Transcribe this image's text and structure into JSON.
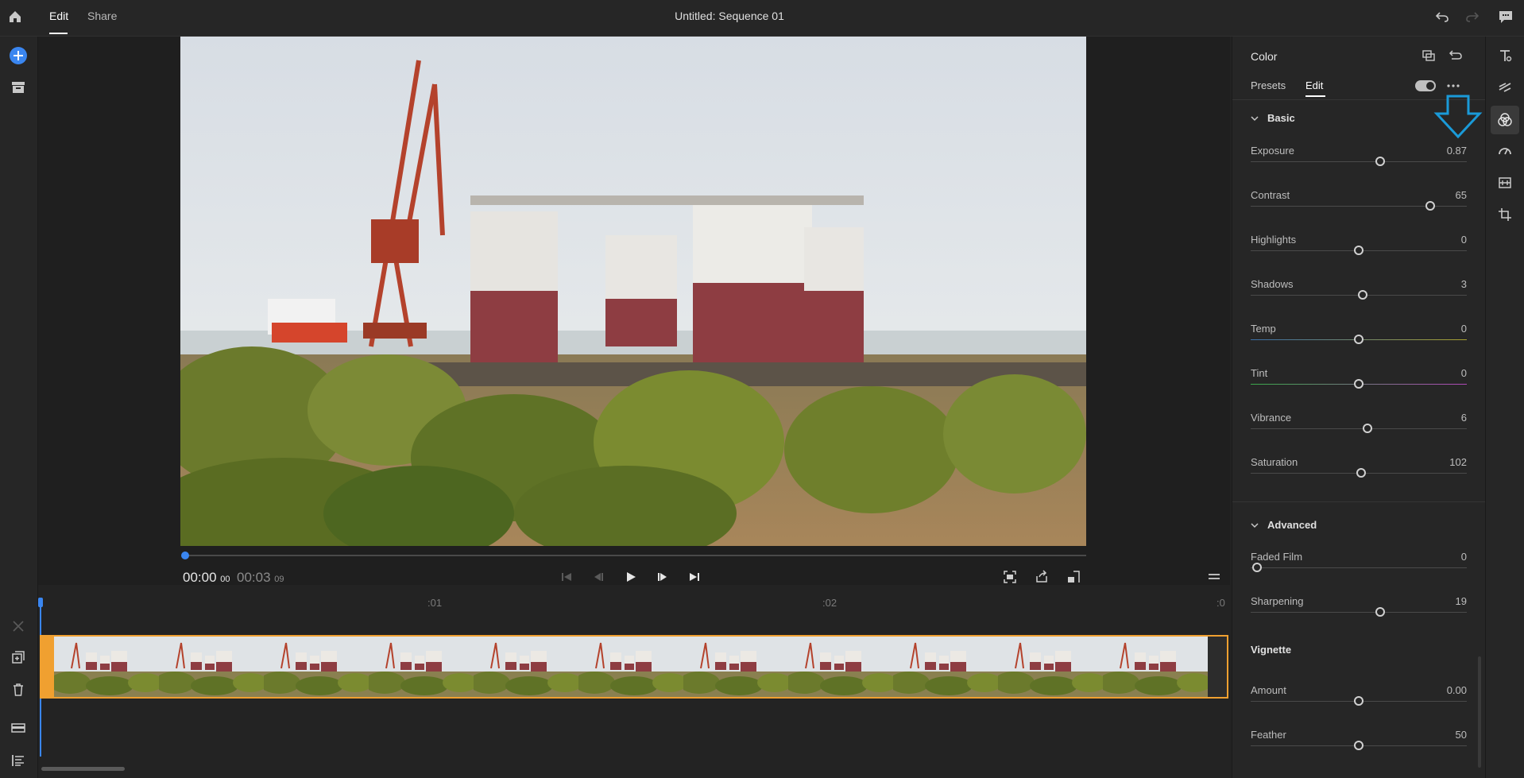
{
  "header": {
    "tabs": [
      {
        "label": "Edit"
      },
      {
        "label": "Share"
      }
    ],
    "title": "Untitled: Sequence 01"
  },
  "player": {
    "current_time": "00:00",
    "current_frames": "00",
    "duration": "00:03",
    "duration_frames": "09",
    "progress": 0.0
  },
  "timeline": {
    "ruler": [
      ":01",
      ":02",
      ":0"
    ],
    "thumb_count": 11
  },
  "panel": {
    "title": "Color",
    "tabs": [
      {
        "label": "Presets"
      },
      {
        "label": "Edit"
      }
    ],
    "basic": {
      "label": "Basic",
      "sliders": [
        {
          "name": "Exposure",
          "value": "0.87",
          "pos": 0.6
        },
        {
          "name": "Contrast",
          "value": "65",
          "pos": 0.83
        },
        {
          "name": "Highlights",
          "value": "0",
          "pos": 0.5
        },
        {
          "name": "Shadows",
          "value": "3",
          "pos": 0.52
        },
        {
          "name": "Temp",
          "value": "0",
          "pos": 0.5
        },
        {
          "name": "Tint",
          "value": "0",
          "pos": 0.5
        },
        {
          "name": "Vibrance",
          "value": "6",
          "pos": 0.54
        },
        {
          "name": "Saturation",
          "value": "102",
          "pos": 0.51
        }
      ]
    },
    "advanced": {
      "label": "Advanced",
      "sliders": [
        {
          "name": "Faded Film",
          "value": "0",
          "pos": 0.03
        },
        {
          "name": "Sharpening",
          "value": "19",
          "pos": 0.6
        }
      ]
    },
    "vignette": {
      "label": "Vignette",
      "sliders": [
        {
          "name": "Amount",
          "value": "0.00",
          "pos": 0.5
        },
        {
          "name": "Feather",
          "value": "50",
          "pos": 0.5
        }
      ]
    }
  },
  "colors": {
    "accent": "#3a86f0",
    "clip_border": "#f0a030",
    "annotation_arrow": "#1a9ad8"
  }
}
